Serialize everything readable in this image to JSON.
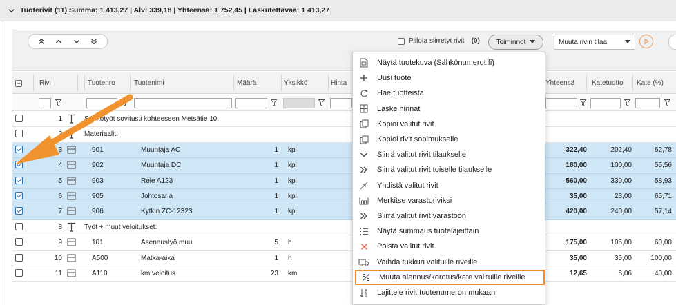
{
  "header": {
    "summary": "Tuoterivit (11) Summa: 1 413,27 | Alv: 339,18 | Yhteensä: 1 752,45 | Laskutettavaa: 1 413,27"
  },
  "toolbar": {
    "hide_moved_label": "Piilota siirretyt rivit",
    "hide_moved_count": "(0)",
    "actions_button": "Toiminnot",
    "row_state_select": "Muuta rivin tilaa"
  },
  "columns": {
    "rivi": "Rivi",
    "tuotenro": "Tuotenro",
    "tuotenimi": "Tuotenimi",
    "maara": "Määrä",
    "yksikko": "Yksikkö",
    "hinta": "Hinta",
    "yhteensa": "Yhteensä",
    "katetuotto": "Katetuotto",
    "kate": "Kate (%)"
  },
  "rows": [
    {
      "no": "1",
      "type": "text",
      "text": "Sähkötyöt sovitusti kohteeseen Metsätie 10.",
      "selected": false
    },
    {
      "no": "2",
      "type": "text",
      "text": "Materiaalit:",
      "selected": false
    },
    {
      "no": "3",
      "type": "product",
      "tuotenro": "901",
      "nimi": "Muuntaja AC",
      "maara": "1",
      "yks": "kpl",
      "yht": "322,40",
      "kt": "202,40",
      "kp": "62,78",
      "selected": true
    },
    {
      "no": "4",
      "type": "product",
      "tuotenro": "902",
      "nimi": "Muuntaja DC",
      "maara": "1",
      "yks": "kpl",
      "yht": "180,00",
      "kt": "100,00",
      "kp": "55,56",
      "selected": true
    },
    {
      "no": "5",
      "type": "product",
      "tuotenro": "903",
      "nimi": "Rele A123",
      "maara": "1",
      "yks": "kpl",
      "yht": "560,00",
      "kt": "330,00",
      "kp": "58,93",
      "selected": true
    },
    {
      "no": "6",
      "type": "product",
      "tuotenro": "905",
      "nimi": "Johtosarja",
      "maara": "1",
      "yks": "kpl",
      "yht": "35,00",
      "kt": "23,00",
      "kp": "65,71",
      "selected": true
    },
    {
      "no": "7",
      "type": "product",
      "tuotenro": "906",
      "nimi": "Kytkin ZC-12323",
      "maara": "1",
      "yks": "kpl",
      "yht": "420,00",
      "kt": "240,00",
      "kp": "57,14",
      "selected": true
    },
    {
      "no": "8",
      "type": "text",
      "text": "Työt + muut veloitukset:",
      "selected": false
    },
    {
      "no": "9",
      "type": "product",
      "tuotenro": "101",
      "nimi": "Asennustyö muu",
      "maara": "5",
      "yks": "h",
      "yht": "175,00",
      "kt": "105,00",
      "kp": "60,00",
      "selected": false
    },
    {
      "no": "10",
      "type": "product",
      "tuotenro": "A500",
      "nimi": "Matka-aika",
      "maara": "1",
      "yks": "h",
      "yht": "35,00",
      "kt": "35,00",
      "kp": "100,00",
      "selected": false
    },
    {
      "no": "11",
      "type": "product",
      "tuotenro": "A110",
      "nimi": "km veloitus",
      "maara": "23",
      "yks": "km",
      "yht": "12,65",
      "kt": "5,06",
      "kp": "40,00",
      "selected": false
    }
  ],
  "menu": [
    {
      "label": "Näytä tuotekuva (Sähkönumerot.fi)",
      "icon": "image-file-icon"
    },
    {
      "label": "Uusi tuote",
      "icon": "plus-icon"
    },
    {
      "label": "Hae tuotteista",
      "icon": "refresh-icon"
    },
    {
      "label": "Laske hinnat",
      "icon": "calculator-icon"
    },
    {
      "label": "Kopioi valitut rivit",
      "icon": "copy-icon"
    },
    {
      "label": "Kopioi rivit sopimukselle",
      "icon": "copy-icon"
    },
    {
      "label": "Siirrä valitut rivit tilaukselle",
      "icon": "chevron-down-icon"
    },
    {
      "label": "Siirrä valitut rivit toiselle tilaukselle",
      "icon": "double-chevron-right-icon"
    },
    {
      "label": "Yhdistä valitut rivit",
      "icon": "merge-icon"
    },
    {
      "label": "Merkitse varastoriviksi",
      "icon": "warehouse-icon"
    },
    {
      "label": "Siirrä valitut rivit varastoon",
      "icon": "double-chevron-right-icon"
    },
    {
      "label": "Näytä summaus tuotelajeittain",
      "icon": "list-icon"
    },
    {
      "label": "Poista valitut rivit",
      "icon": "close-icon"
    },
    {
      "label": "Vaihda tukkuri valituille riveille",
      "icon": "truck-icon"
    },
    {
      "label": "Muuta alennus/korotus/kate valituille riveille",
      "icon": "percent-icon"
    },
    {
      "label": "Lajittele rivit tuotenumeron mukaan",
      "icon": "sort-icon"
    }
  ],
  "colors": {
    "selected_row": "#cfe6f7",
    "highlight": "#ef8b2f",
    "arrow": "#f0922e"
  }
}
